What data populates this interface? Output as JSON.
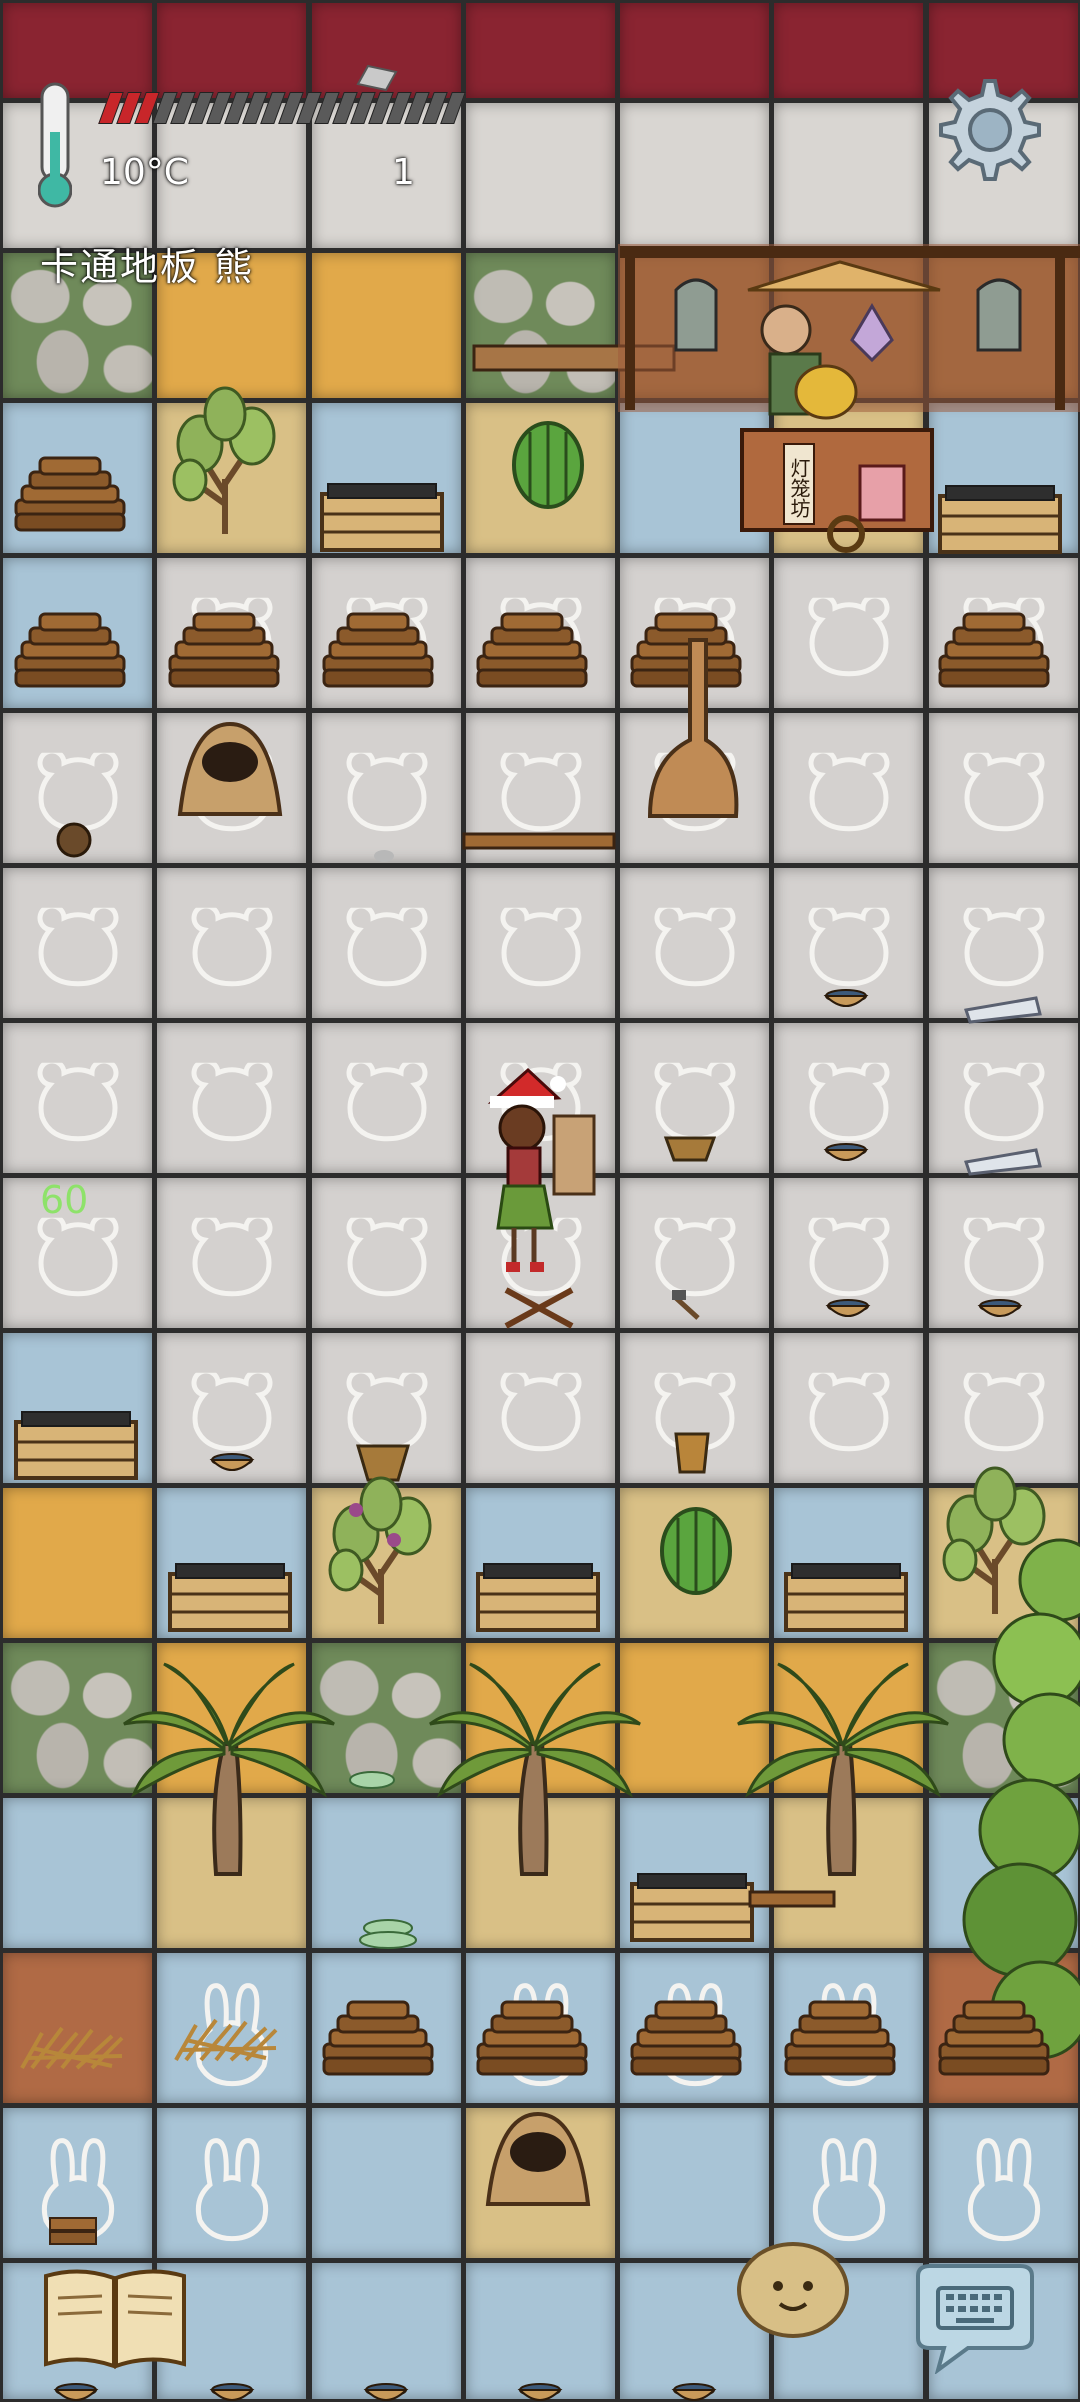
{
  "hud": {
    "temperature": "10°C",
    "count": "1",
    "tile_name": "卡通地板 熊",
    "fps": "60",
    "hunger_full": 3,
    "hunger_total": 20
  },
  "icons": {
    "settings": "gear-icon",
    "recipe_book": "book-icon",
    "emote": "potato-face-icon",
    "chat": "keyboard-icon",
    "temperature": "thermometer-icon"
  },
  "vendor": {
    "sign": "灯笼坊"
  },
  "colors": {
    "accent_red": "#c8262a",
    "fps_green": "#8ee26a",
    "tile_blue": "#a8c4d6",
    "tile_sand": "#e1a94a",
    "roof_red": "#8a2431"
  },
  "grid": [
    [
      "red",
      "red",
      "red",
      "red",
      "red",
      "red",
      "red"
    ],
    [
      "gray",
      "gray",
      "gray",
      "gray",
      "gray",
      "gray",
      "gray"
    ],
    [
      "stone",
      "sand",
      "sand",
      "stone",
      "wood",
      "wood",
      "wood"
    ],
    [
      "blue",
      "yellow",
      "blue",
      "yellow",
      "blue",
      "yellow",
      "blue"
    ],
    [
      "blue",
      "bear",
      "bear",
      "bear",
      "bear",
      "bear",
      "bear"
    ],
    [
      "bear",
      "bear",
      "bear",
      "bear",
      "bear",
      "bear",
      "bear"
    ],
    [
      "bear",
      "bear",
      "bear",
      "bear",
      "bear",
      "bear",
      "bear"
    ],
    [
      "bear",
      "bear",
      "bear",
      "bear",
      "bear",
      "bear",
      "bear"
    ],
    [
      "bear",
      "bear",
      "bear",
      "bear",
      "bear",
      "bear",
      "bear"
    ],
    [
      "blue",
      "bear",
      "bear",
      "bear",
      "bear",
      "bear",
      "bear"
    ],
    [
      "sand",
      "blue",
      "yellow",
      "blue",
      "yellow",
      "blue",
      "yellow"
    ],
    [
      "stone",
      "sand",
      "stone",
      "sand",
      "sand",
      "sand",
      "stone"
    ],
    [
      "blue",
      "yellow",
      "blue",
      "yellow",
      "blue",
      "yellow",
      "blue"
    ],
    [
      "rust",
      "bunny",
      "blue",
      "bunny",
      "bunny",
      "bunny",
      "rust"
    ],
    [
      "bunny",
      "bunny",
      "blue",
      "yellow",
      "blue",
      "bunny",
      "bunny"
    ],
    [
      "blue",
      "blue",
      "blue",
      "blue",
      "blue",
      "blue",
      "blue"
    ]
  ]
}
